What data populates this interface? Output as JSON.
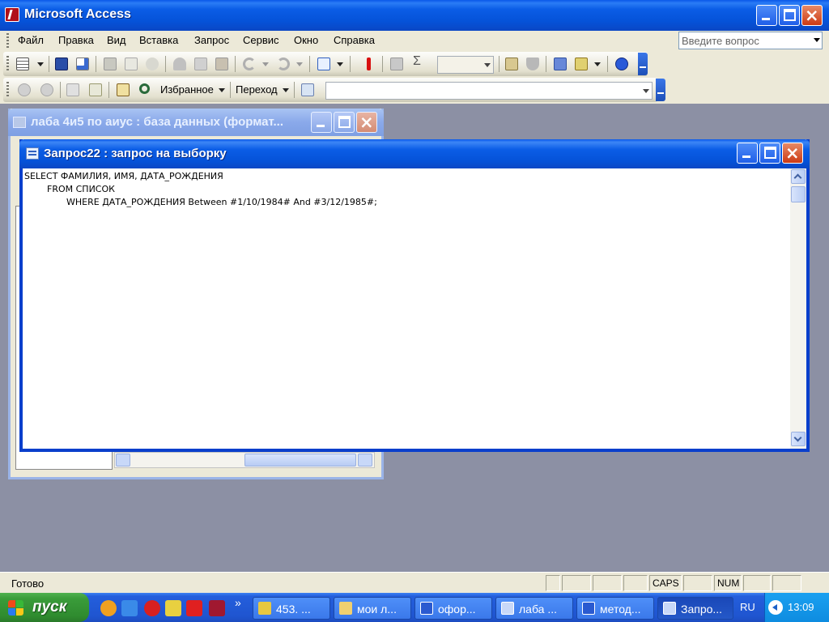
{
  "window": {
    "title": "Microsoft Access"
  },
  "menu": {
    "items": [
      "Файл",
      "Правка",
      "Вид",
      "Вставка",
      "Запрос",
      "Сервис",
      "Окно",
      "Справка"
    ],
    "ask_placeholder": "Введите вопрос"
  },
  "web_toolbar": {
    "favorites_label": "Избранное",
    "go_label": "Переход",
    "address_value": ""
  },
  "db_window": {
    "title": "лаба 4и5 по аиус : база данных (формат..."
  },
  "query_window": {
    "title": "Запрос22 : запрос на выборку",
    "sql_lines": [
      "SELECT ФАМИЛИЯ, ИМЯ, ДАТА_РОЖДЕНИЯ",
      "FROM СПИСОК",
      "WHERE ДАТА_РОЖДЕНИЯ Between #1/10/1984# And #3/12/1985#;"
    ]
  },
  "status": {
    "text": "Готово",
    "caps": "CAPS",
    "num": "NUM"
  },
  "taskbar": {
    "start_label": "пуск",
    "buttons": [
      {
        "label": "453. ...",
        "icon": "lightning-icon"
      },
      {
        "label": "мои л...",
        "icon": "folder-icon"
      },
      {
        "label": "офор...",
        "icon": "word-icon"
      },
      {
        "label": "лаба ...",
        "icon": "access-db-icon"
      },
      {
        "label": "метод...",
        "icon": "word-icon"
      },
      {
        "label": "Запро...",
        "icon": "access-query-icon"
      }
    ],
    "language": "RU",
    "clock": "13:09",
    "overflow_glyph": "»"
  },
  "colors": {
    "xp_blue": "#0552d8",
    "start_green": "#3a9c3a",
    "chrome": "#ece9d8",
    "mdi_background": "#8c90a4"
  }
}
